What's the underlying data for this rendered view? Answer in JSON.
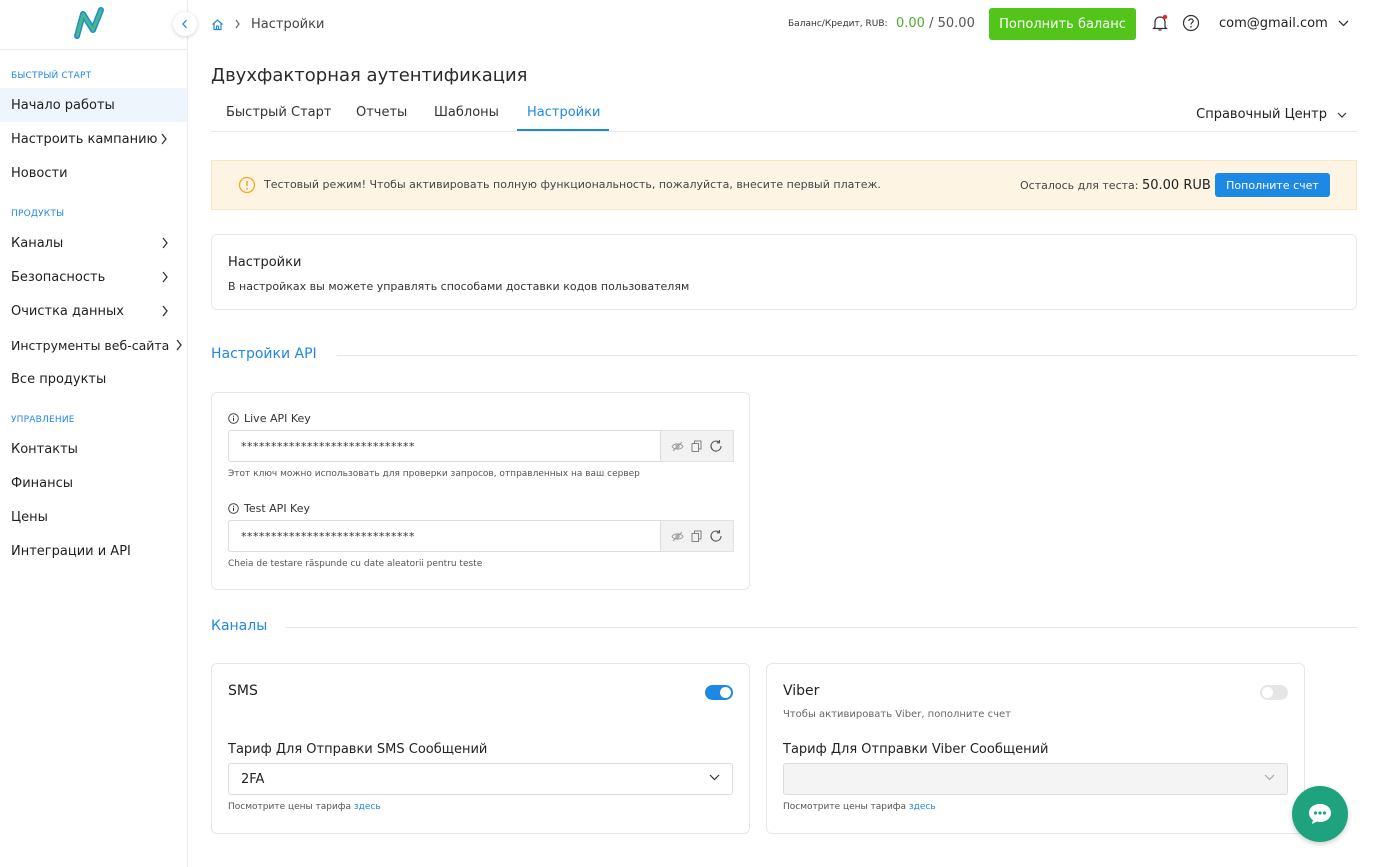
{
  "sidebar": {
    "sections": [
      "Быстрый старт",
      "Продукты",
      "Управление"
    ],
    "items": [
      {
        "label": "Начало работы"
      },
      {
        "label": "Настроить кампанию"
      },
      {
        "label": "Новости"
      },
      {
        "label": "Каналы"
      },
      {
        "label": "Безопасность"
      },
      {
        "label": "Очистка данных"
      },
      {
        "label": "Инструменты веб-сайта"
      },
      {
        "label": "Все продукты"
      },
      {
        "label": "Контакты"
      },
      {
        "label": "Финансы"
      },
      {
        "label": "Цены"
      },
      {
        "label": "Интеграции и API"
      }
    ]
  },
  "header": {
    "breadcrumb": "Настройки",
    "balance_label": "Баланс/Кредит, RUB:",
    "balance_value": "0.00",
    "balance_separator": "/",
    "credit_value": "50.00",
    "topup_label": "Пополнить баланс",
    "user_email": "com@gmail.com"
  },
  "page": {
    "title": "Двухфакторная аутентификация",
    "tabs": [
      "Быстрый Старт",
      "Отчеты",
      "Шаблоны",
      "Настройки"
    ],
    "help_center": "Справочный Центр"
  },
  "alert": {
    "text": "Тестовый режим! Чтобы активировать полную функциональность, пожалуйста, внесите первый платеж.",
    "remaining_label": "Осталось для теста:",
    "remaining_value": "50.00 RUB",
    "button": "Пополните счет"
  },
  "settings_card": {
    "title": "Настройки",
    "desc": "В настройках вы можете управлять способами доставки кодов пользователям"
  },
  "api": {
    "heading": "Настройки API",
    "live_label": "Live API Key",
    "live_value": "*****************************",
    "live_help": "Этот ключ можно использовать для проверки запросов, отправленных на ваш сервер",
    "test_label": "Test API Key",
    "test_value": "*****************************",
    "test_help": "Cheia de testare răspunde cu date aleatorii pentru teste"
  },
  "channels": {
    "heading": "Каналы",
    "sms": {
      "title": "SMS",
      "enabled": true,
      "tariff_label": "Тариф Для Отправки SMS Сообщений",
      "tariff_value": "2FA",
      "note": "Посмотрите цены тарифа",
      "note_link": "здесь"
    },
    "viber": {
      "title": "Viber",
      "enabled": false,
      "subtitle": "Чтобы активировать Viber, пополните счет",
      "tariff_label": "Тариф Для Отправки Viber Сообщений",
      "tariff_value": "",
      "note": "Посмотрите цены тарифа",
      "note_link": "здесь"
    }
  },
  "colors": {
    "accent": "#1e88e5",
    "success": "#52c41a",
    "chat": "#1fa37f"
  }
}
